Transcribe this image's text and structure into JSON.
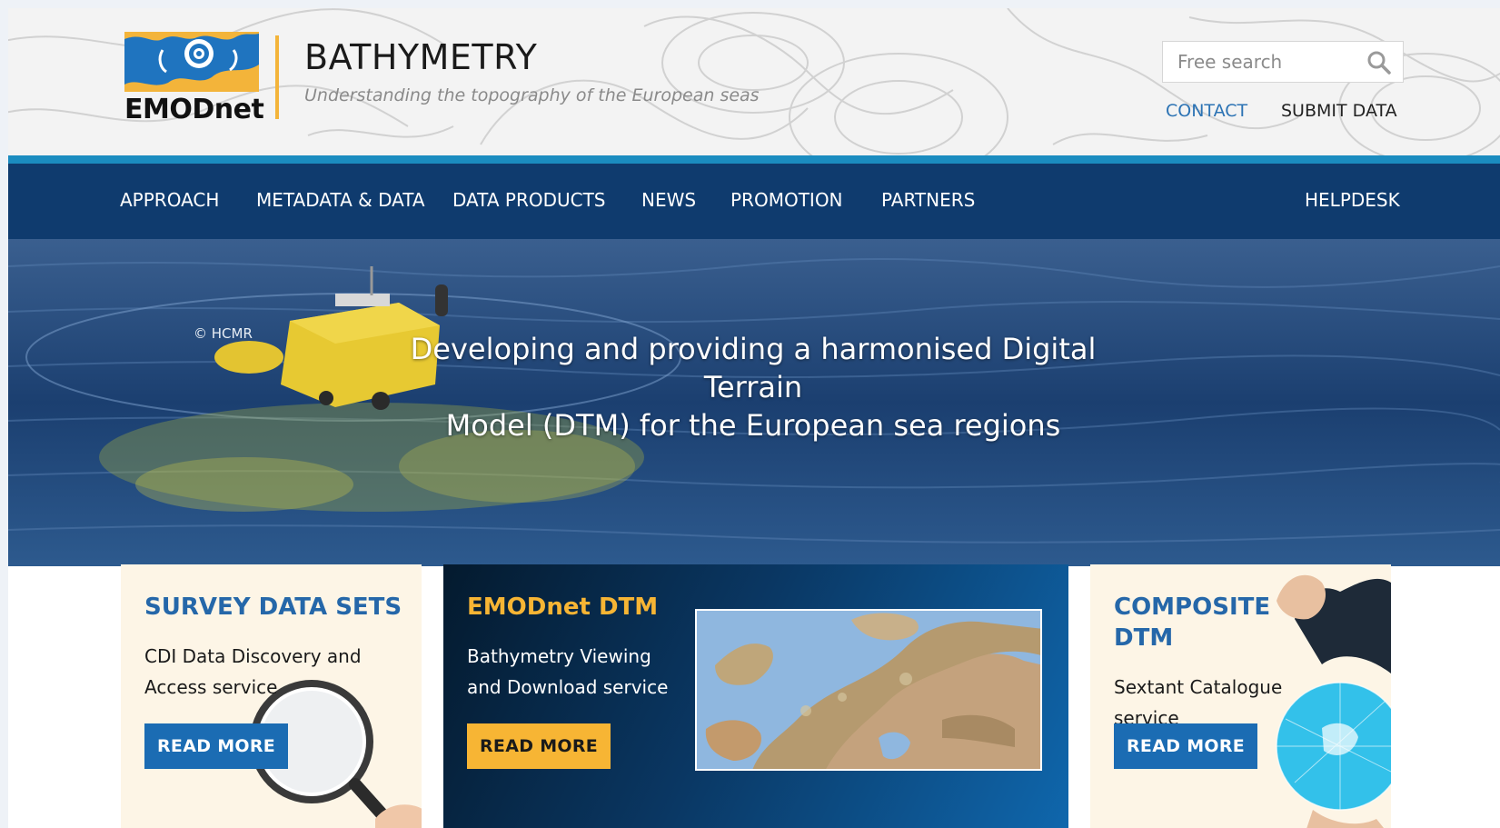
{
  "brand": {
    "logo_text": "EMODnet",
    "title": "BATHYMETRY",
    "subtitle": "Understanding the topography of the European seas"
  },
  "search": {
    "placeholder": "Free search"
  },
  "utility_links": {
    "contact": "CONTACT",
    "submit_data": "SUBMIT DATA"
  },
  "nav": {
    "items": [
      "APPROACH",
      "METADATA & DATA",
      "DATA PRODUCTS",
      "NEWS",
      "PROMOTION",
      "PARTNERS"
    ],
    "helpdesk": "HELPDESK"
  },
  "hero": {
    "credit": "© HCMR",
    "headline_line1": "Developing and providing a harmonised Digital Terrain",
    "headline_line2": "Model (DTM) for the European sea regions"
  },
  "cards": [
    {
      "title": "SURVEY DATA SETS",
      "description": "CDI Data Discovery and Access service",
      "button": "READ MORE"
    },
    {
      "title": "EMODnet DTM",
      "description": "Bathymetry Viewing and Download service",
      "button": "READ MORE"
    },
    {
      "title_line1": "COMPOSITE",
      "title_line2": "DTM",
      "description": "Sextant Catalogue service",
      "button": "READ MORE"
    }
  ],
  "colors": {
    "navy": "#0f3b6e",
    "accent_blue": "#1b8cc0",
    "link_blue": "#2c73b4",
    "yellow": "#f7b534",
    "card_cream": "#fdf5e6"
  },
  "icons": [
    "emodnet-logo-icon",
    "search-icon",
    "magnifier-illustration-icon",
    "globe-illustration-icon"
  ]
}
